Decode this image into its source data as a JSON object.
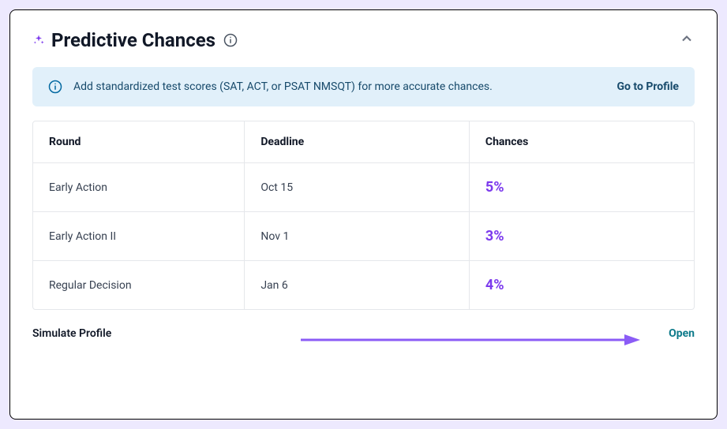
{
  "header": {
    "title": "Predictive Chances"
  },
  "banner": {
    "message": "Add standardized test scores (SAT, ACT, or PSAT NMSQT) for more accurate chances.",
    "action_label": "Go to Profile"
  },
  "table": {
    "headers": {
      "round": "Round",
      "deadline": "Deadline",
      "chances": "Chances"
    },
    "rows": [
      {
        "round": "Early Action",
        "deadline": "Oct 15",
        "chances": "5%"
      },
      {
        "round": "Early Action II",
        "deadline": "Nov 1",
        "chances": "3%"
      },
      {
        "round": "Regular Decision",
        "deadline": "Jan 6",
        "chances": "4%"
      }
    ]
  },
  "footer": {
    "simulate_label": "Simulate Profile",
    "open_label": "Open"
  },
  "colors": {
    "accent": "#7c3aed",
    "link_teal": "#0d7a8a",
    "banner_bg": "#e1f0fa",
    "banner_text": "#174a6b"
  }
}
